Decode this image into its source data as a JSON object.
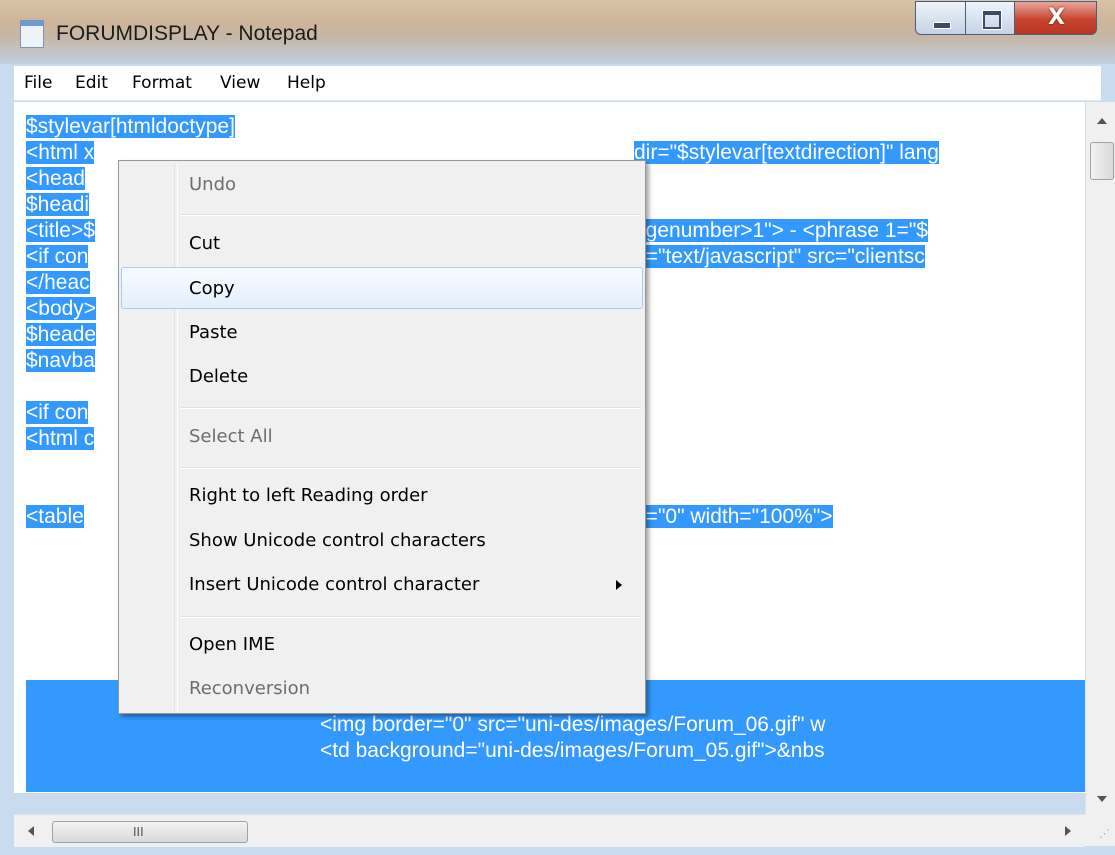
{
  "window": {
    "title": "FORUMDISPLAY - Notepad"
  },
  "menubar": {
    "items": [
      "File",
      "Edit",
      "Format",
      "View",
      "Help"
    ]
  },
  "editor": {
    "lines": [
      "$stylevar[htmldoctype]",
      "<html x",
      "<head",
      "$headi",
      "<title>$",
      "<if con",
      "</heac",
      "<body>",
      "$heade",
      "$navba",
      "",
      "<if con",
      "<html c",
      "",
      "<table"
    ],
    "right_fragments": [
      {
        "row": 2,
        "text": "dir=\"$stylevar[textdirection]\" lang"
      },
      {
        "row": 5,
        "text": "agenumber>1\"> - <phrase 1=\"$"
      },
      {
        "row": 6,
        "text": "e=\"text/javascript\" src=\"clientsc"
      },
      {
        "row": 15,
        "text": "g=\"0\" width=\"100%\">"
      }
    ],
    "lower_lines": [
      "<img border=\"0\" src=\"uni-des/images/Forum_06.gif\" w",
      "<td background=\"uni-des/images/Forum_05.gif\">&nbs"
    ],
    "selection_color": "#3399ff"
  },
  "context_menu": {
    "items": [
      {
        "label": "Undo",
        "enabled": false
      },
      {
        "label": "Cut",
        "enabled": true
      },
      {
        "label": "Copy",
        "enabled": true,
        "highlighted": true
      },
      {
        "label": "Paste",
        "enabled": true
      },
      {
        "label": "Delete",
        "enabled": true
      },
      {
        "label": "Select All",
        "enabled": false
      },
      {
        "label": "Right to left Reading order",
        "enabled": true
      },
      {
        "label": "Show Unicode control characters",
        "enabled": true
      },
      {
        "label": "Insert Unicode control character",
        "enabled": true,
        "submenu": true
      },
      {
        "label": "Open IME",
        "enabled": true
      },
      {
        "label": "Reconversion",
        "enabled": false
      }
    ]
  },
  "scrollbar": {
    "h_grip": "III",
    "size_grip": "⋰"
  },
  "colors": {
    "title_close": "#c8442f",
    "menu_highlight_border": "#a9cbef"
  }
}
